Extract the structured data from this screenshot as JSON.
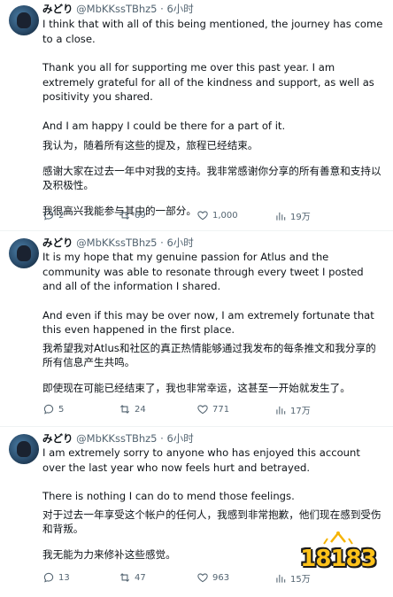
{
  "tweets": [
    {
      "name": "みどり",
      "handle": "@MbKKssTBhz5",
      "time": "6小时",
      "paragraphs": [
        "I think that with all of this being mentioned, the journey has come to a close.",
        "Thank you all for supporting me over this past year. I am extremely grateful for all of the kindness and support, as well as positivity you shared.",
        "And I am happy I could be there for a part of it."
      ],
      "translation": [
        "我认为，随着所有这些的提及，旅程已经结束。",
        "感谢大家在过去一年中对我的支持。我非常感谢你分享的所有善意和支持以及积极性。",
        "我很高兴我能参与其中的一部分。"
      ],
      "replies": "2",
      "retweets": "69",
      "likes": "1,000",
      "views": "19万"
    },
    {
      "name": "みどり",
      "handle": "@MbKKssTBhz5",
      "time": "6小时",
      "paragraphs": [
        "It is my hope that my genuine passion for Atlus and the community was able to resonate through every tweet I posted and all of the information I shared.",
        "And even if this may be over now, I am extremely fortunate that this even happened in the first place."
      ],
      "translation": [
        "我希望我对Atlus和社区的真正热情能够通过我发布的每条推文和我分享的所有信息产生共鸣。",
        "即使现在可能已经结束了，我也非常幸运，这甚至一开始就发生了。"
      ],
      "replies": "5",
      "retweets": "24",
      "likes": "771",
      "views": "17万"
    },
    {
      "name": "みどり",
      "handle": "@MbKKssTBhz5",
      "time": "6小时",
      "paragraphs": [
        "I am extremely sorry to anyone who has enjoyed this account over the last year who now feels hurt and betrayed.",
        "There is nothing I can do to mend those feelings."
      ],
      "translation": [
        "对于过去一年享受这个帐户的任何人，我感到非常抱歉，他们现在感到受伤和背叛。",
        "我无能为力来修补这些感觉。"
      ],
      "replies": "13",
      "retweets": "47",
      "likes": "963",
      "views": "15万"
    }
  ],
  "watermark": {
    "text": "18183",
    "color": "#ffc21a"
  }
}
